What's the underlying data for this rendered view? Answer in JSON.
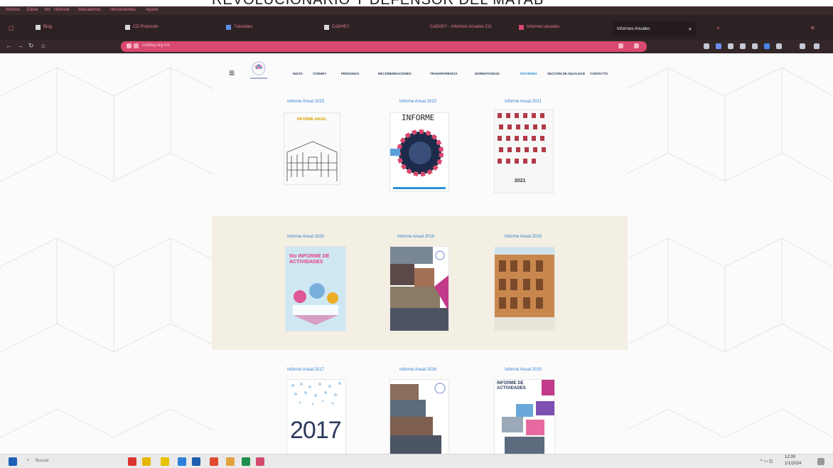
{
  "caption": {
    "text": "REVOLUCIONARIO Y DEFENSOR DEL MAYAB"
  },
  "browser": {
    "menu": [
      "Archivo",
      "Editar",
      "Ver",
      "Historial",
      "Marcadores",
      "Herramientas",
      "Ayuda"
    ],
    "tabs": [
      {
        "label": "Blog"
      },
      {
        "label": "CD Protocolo"
      },
      {
        "label": "Tutoriales"
      },
      {
        "label": "CoDHEY"
      },
      {
        "label": "CoDHEY - Informes Anuales CG"
      },
      {
        "label": "Informes anuales",
        "active": true
      },
      {
        "label": "Informes Anuales"
      }
    ],
    "url": "codhey.org.mx"
  },
  "site": {
    "nav": [
      {
        "label": "INICIO"
      },
      {
        "label": "CODHEY"
      },
      {
        "label": "PERSONAS"
      },
      {
        "label": "RECOMENDACIONES"
      },
      {
        "label": "TRANSPARENCIA"
      },
      {
        "label": "NORMATIVIDAD"
      },
      {
        "label": "INFORMES",
        "active": true
      },
      {
        "label": "SECCIÓN DE IGUALDAD"
      },
      {
        "label": "CONTACTO"
      }
    ],
    "reports": [
      {
        "title": "Informe Anual 2023",
        "cover_text": "INFORME ANUAL"
      },
      {
        "title": "Informe Anual 2022",
        "cover_text": "INFORME"
      },
      {
        "title": "Informe Anual 2021",
        "cover_text": "2021"
      },
      {
        "title": "Informe Anual 2020",
        "cover_text": "5to INFORME DE ACTIVIDADES"
      },
      {
        "title": "Informe Anual 2019",
        "cover_text": ""
      },
      {
        "title": "Informe Anual 2018",
        "cover_text": ""
      },
      {
        "title": "Informe Anual 2017",
        "cover_text": "2017"
      },
      {
        "title": "Informe Anual 2016",
        "cover_text": ""
      },
      {
        "title": "Informe Anual 2015",
        "cover_text": "INFORME DE ACTIVIDADES"
      }
    ]
  },
  "taskbar": {
    "search_placeholder": "Buscar",
    "clock": "12:00",
    "clock_date": "1/1/2024"
  },
  "colors": {
    "accent": "#2f8fd6",
    "urlbar": "#d9486e",
    "chrome": "#2c2224",
    "beige": "#f3efe2"
  }
}
